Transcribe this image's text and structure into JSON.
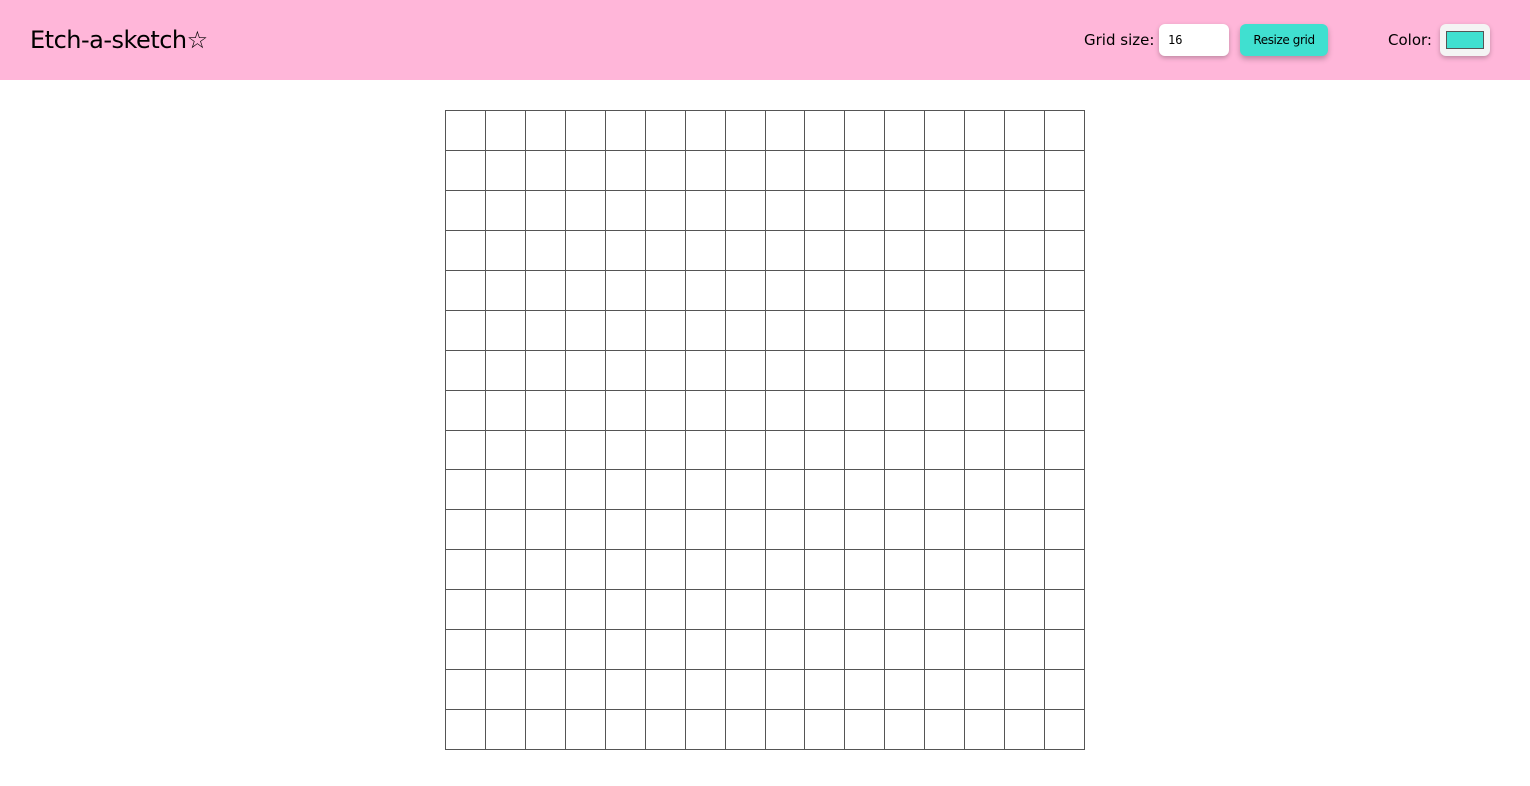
{
  "header": {
    "title": "Etch-a-sketch☆",
    "grid_size_label": "Grid size:",
    "grid_size_value": "16",
    "resize_button_label": "Resize grid",
    "color_label": "Color:",
    "color_value": "#40e0d0"
  },
  "colors": {
    "header_background": "#ffb6d9",
    "accent": "#40e0d0",
    "grid_line": "#555555"
  },
  "grid": {
    "size": 16
  }
}
